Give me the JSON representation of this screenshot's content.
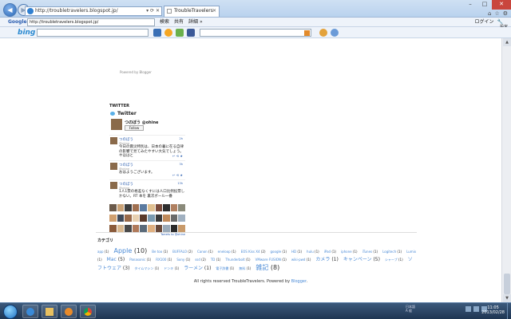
{
  "browser": {
    "address_url": "http://troubletravelers.blogspot.jp/",
    "tab_title": "TroubleTravelers",
    "window_controls": [
      "–",
      "□",
      "✕"
    ],
    "right_icons": [
      "home-icon",
      "star-icon",
      "gear-icon"
    ]
  },
  "google_toolbar": {
    "logo": "Google",
    "search_value": "http://troubletravelers.blogspot.jp/",
    "items": [
      "検索",
      "共有",
      "詳細 »"
    ],
    "login": "ログイン",
    "settings": "設定"
  },
  "bing_toolbar": {
    "logo": "bing"
  },
  "page": {
    "powered_text": "Powered by Blogger",
    "twitter_section": "TWITTER",
    "widget_title": "Twitter",
    "profile": {
      "name": "つのぼう @ohine",
      "follow": "Follow"
    },
    "tweets": [
      {
        "name": "つのぼう",
        "handle": "@ohine",
        "time": "2h",
        "text": "今日の震災特別は、日本の暮に在る自律の影響で見てみたやすい大気でしょう。やほはと"
      },
      {
        "name": "つのぼう",
        "handle": "@ohine",
        "time": "3h",
        "text": "おはようございます。"
      },
      {
        "name": "つのぼう",
        "handle": "@ohine",
        "time": "13h",
        "text": "1人1票の格差なくすには人口比例投票しかない。RT 本を 裏次ボール一番"
      }
    ],
    "tweet_actions": "↩ ⟲ ★",
    "widget_footer": "Tweets to @ohine",
    "categories_heading": "カテゴリ",
    "categories": [
      {
        "label": "app",
        "count": "(1)",
        "size": "sm"
      },
      {
        "label": "Apple",
        "count": "(10)",
        "size": "lg"
      },
      {
        "label": "Be too",
        "count": "(1)",
        "size": "sm"
      },
      {
        "label": "BUFFALO",
        "count": "(2)",
        "size": "sm"
      },
      {
        "label": "Canon",
        "count": "(1)",
        "size": "sm"
      },
      {
        "label": "eneloop",
        "count": "(1)",
        "size": "sm"
      },
      {
        "label": "EOS Kiss X4",
        "count": "(2)",
        "size": "sm"
      },
      {
        "label": "google",
        "count": "(1)",
        "size": "sm"
      },
      {
        "label": "HD",
        "count": "(1)",
        "size": "sm"
      },
      {
        "label": "hulu",
        "count": "(1)",
        "size": "sm"
      },
      {
        "label": "iPad",
        "count": "(1)",
        "size": "sm"
      },
      {
        "label": "iphone",
        "count": "(1)",
        "size": "sm"
      },
      {
        "label": "iTunes",
        "count": "(1)",
        "size": "sm"
      },
      {
        "label": "Logitech",
        "count": "(1)",
        "size": "sm"
      },
      {
        "label": "Lumix",
        "count": "(1)",
        "size": "sm"
      },
      {
        "label": "Mac",
        "count": "(5)",
        "size": "md"
      },
      {
        "label": "Panasonic",
        "count": "(1)",
        "size": "sm"
      },
      {
        "label": "RX100",
        "count": "(1)",
        "size": "sm"
      },
      {
        "label": "Sony",
        "count": "(1)",
        "size": "sm"
      },
      {
        "label": "ssd",
        "count": "(2)",
        "size": "sm"
      },
      {
        "label": "TD",
        "count": "(1)",
        "size": "sm"
      },
      {
        "label": "Thunderbolt",
        "count": "(1)",
        "size": "sm"
      },
      {
        "label": "VMware FUSION",
        "count": "(1)",
        "size": "sm"
      },
      {
        "label": "wiki-pwd",
        "count": "(1)",
        "size": "sm"
      },
      {
        "label": "カメラ",
        "count": "(1)",
        "size": "md"
      },
      {
        "label": "キャンペーン",
        "count": "(5)",
        "size": "md"
      },
      {
        "label": "シャープ",
        "count": "(1)",
        "size": "sm"
      },
      {
        "label": "ソフトウェア",
        "count": "(3)",
        "size": "md"
      },
      {
        "label": "タイムマシン",
        "count": "(1)",
        "size": "sm"
      },
      {
        "label": "ドンキ",
        "count": "(1)",
        "size": "sm"
      },
      {
        "label": "ラーメン",
        "count": "(1)",
        "size": "md"
      },
      {
        "label": "電子辞書",
        "count": "(1)",
        "size": "sm"
      },
      {
        "label": "無料",
        "count": "(1)",
        "size": "sm"
      },
      {
        "label": "雑記",
        "count": "(8)",
        "size": "lg"
      }
    ],
    "footer_text": "All rights reserved TroubleTravelers. Powered by ",
    "footer_link": "Blogger",
    "footer_end": "."
  },
  "taskbar": {
    "lang": "日本語\nA 般",
    "time": "11:05",
    "date": "2013/02/28"
  },
  "colors": {
    "accent_link": "#4a8ad6",
    "taskbar": "#1f3552",
    "close_button": "#c9463d"
  }
}
